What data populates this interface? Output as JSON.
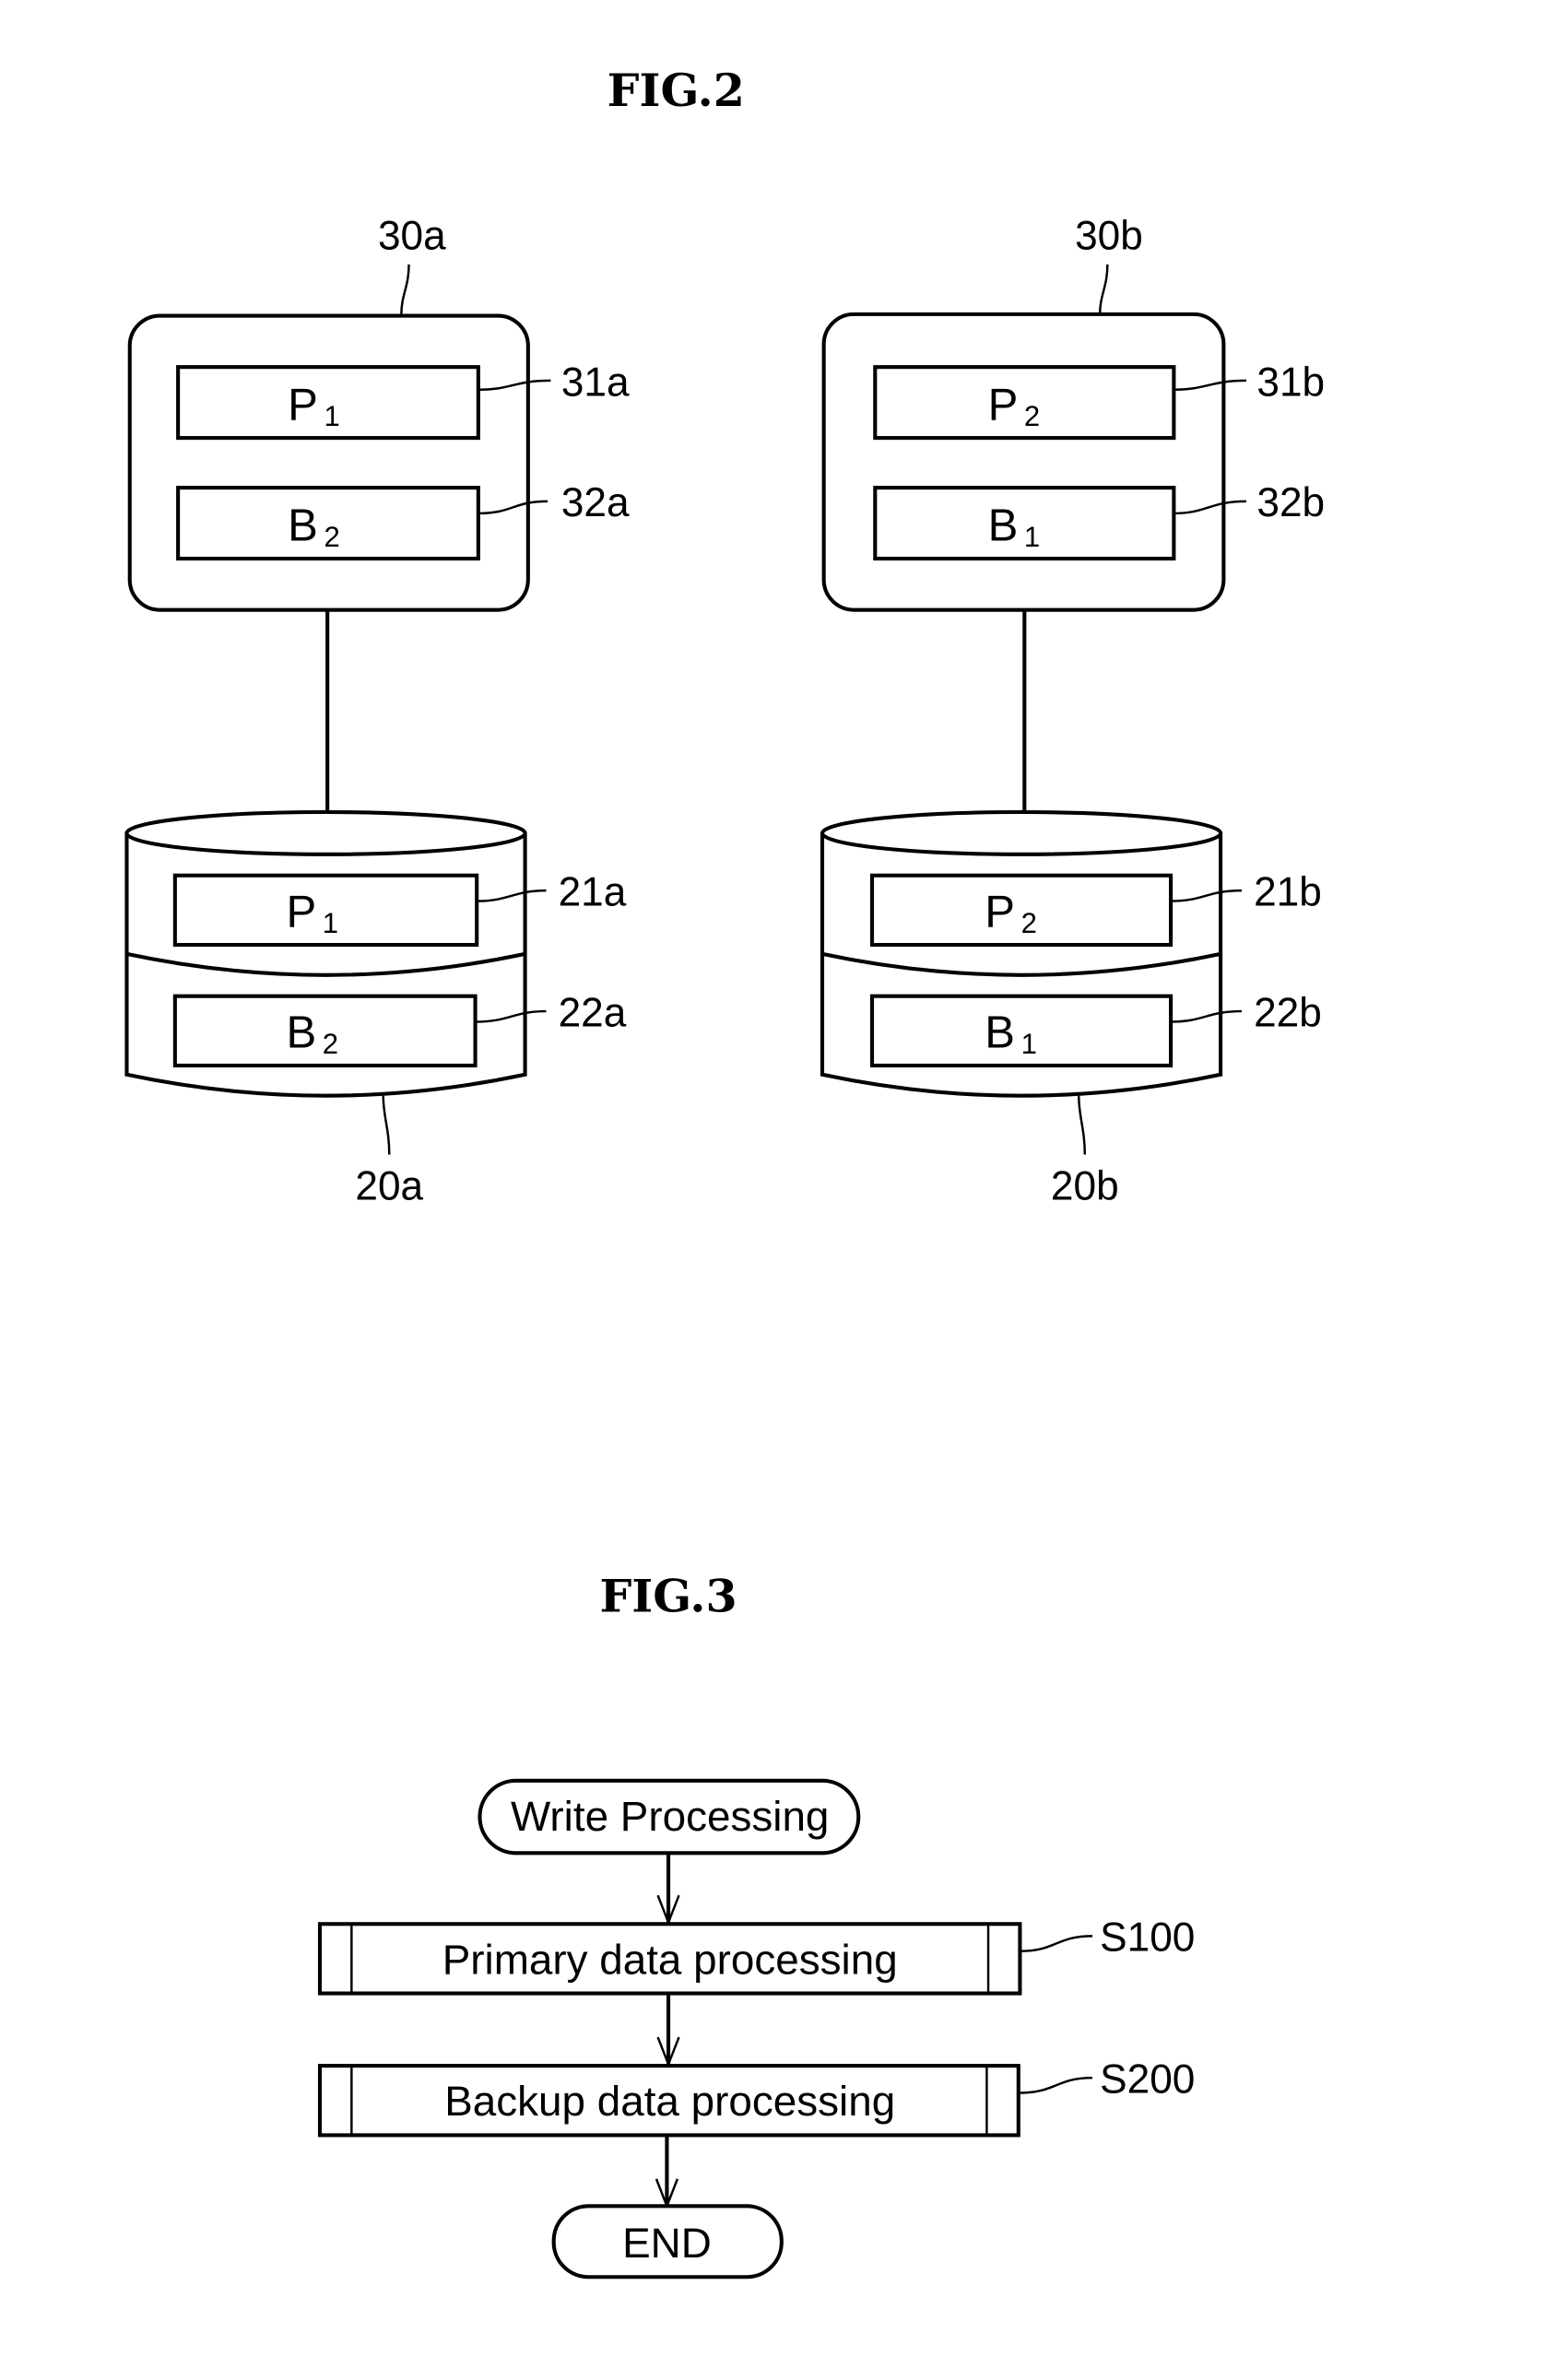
{
  "fig2": {
    "title": "FIG.2",
    "nodes": [
      {
        "computer_ref": "30a",
        "computer_cells": [
          {
            "ref": "31a",
            "letter": "P",
            "index": "1"
          },
          {
            "ref": "32a",
            "letter": "B",
            "index": "2"
          }
        ],
        "storage_ref": "20a",
        "storage_cells": [
          {
            "ref": "21a",
            "letter": "P",
            "index": "1"
          },
          {
            "ref": "22a",
            "letter": "B",
            "index": "2"
          }
        ]
      },
      {
        "computer_ref": "30b",
        "computer_cells": [
          {
            "ref": "31b",
            "letter": "P",
            "index": "2"
          },
          {
            "ref": "32b",
            "letter": "B",
            "index": "1"
          }
        ],
        "storage_ref": "20b",
        "storage_cells": [
          {
            "ref": "21b",
            "letter": "P",
            "index": "2"
          },
          {
            "ref": "22b",
            "letter": "B",
            "index": "1"
          }
        ]
      }
    ]
  },
  "fig3": {
    "title": "FIG.3",
    "start": "Write Processing",
    "steps": [
      {
        "label": "Primary data processing",
        "ref": "S100"
      },
      {
        "label": "Backup data processing",
        "ref": "S200"
      }
    ],
    "end": "END"
  }
}
